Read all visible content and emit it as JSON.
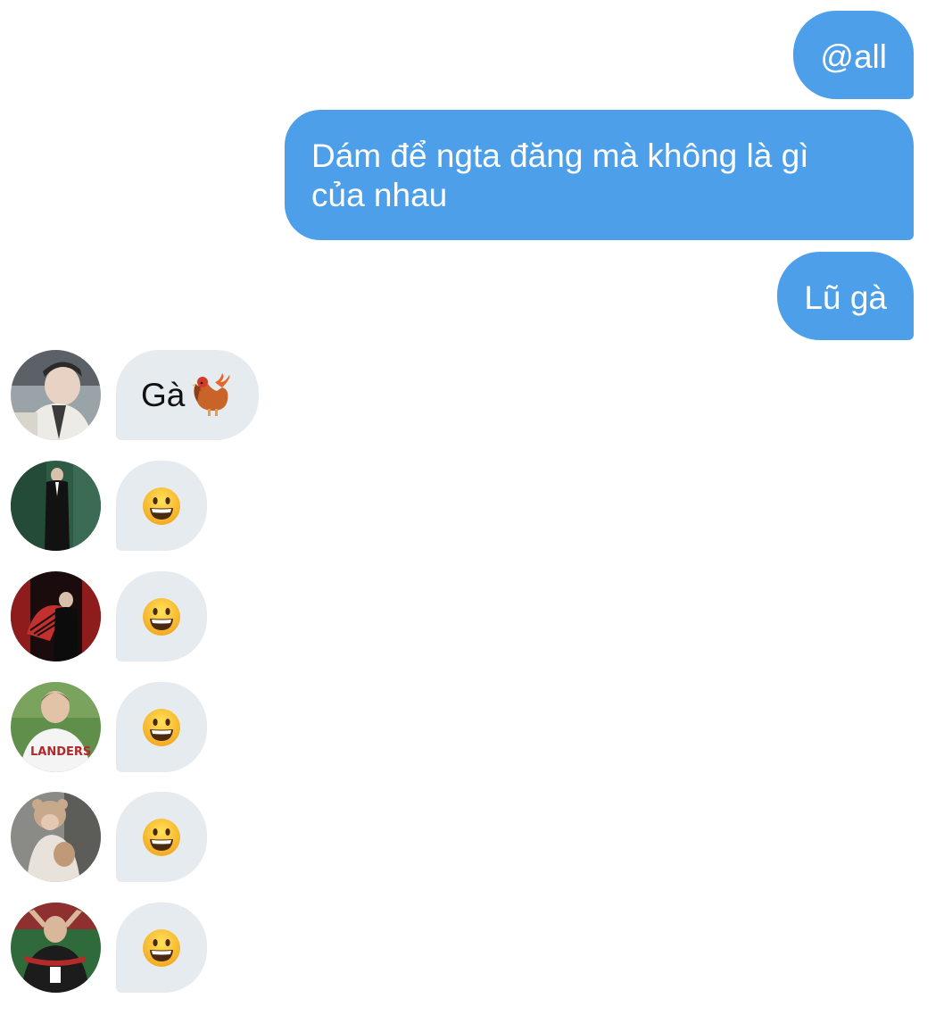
{
  "outgoing": [
    {
      "text": "@all"
    },
    {
      "text": "Dám để ngta đăng mà không là gì\ncủa nhau"
    },
    {
      "text": "Lũ gà"
    }
  ],
  "incoming": [
    {
      "text": "Gà",
      "emoji": "rooster-icon",
      "avatar": "avatar-1"
    },
    {
      "text": "",
      "emoji": "smiley-icon",
      "avatar": "avatar-2"
    },
    {
      "text": "",
      "emoji": "smiley-icon",
      "avatar": "avatar-3"
    },
    {
      "text": "",
      "emoji": "smiley-icon",
      "avatar": "avatar-4"
    },
    {
      "text": "",
      "emoji": "smiley-icon",
      "avatar": "avatar-5"
    },
    {
      "text": "",
      "emoji": "smiley-icon",
      "avatar": "avatar-6"
    }
  ],
  "colors": {
    "outgoing_bubble": "#4e9fe9",
    "incoming_bubble": "#e6ebf0",
    "background": "#ffffff"
  }
}
